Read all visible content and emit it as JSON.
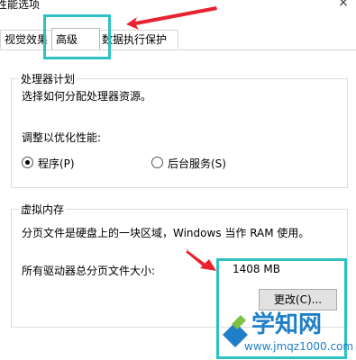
{
  "window": {
    "title": "性能选项",
    "close_glyph": "×"
  },
  "tabs": [
    {
      "label": "视觉效果",
      "selected": false
    },
    {
      "label": "高级",
      "selected": true
    },
    {
      "label": "数据执行保护",
      "selected": false
    }
  ],
  "processor_group": {
    "legend": "处理器计划",
    "description": "选择如何分配处理器资源。",
    "adjust_label": "调整以优化性能:",
    "options": [
      {
        "label": "程序(P)",
        "selected": true
      },
      {
        "label": "后台服务(S)",
        "selected": false
      }
    ]
  },
  "virtual_memory_group": {
    "legend": "虚拟内存",
    "description": "分页文件是硬盘上的一块区域，Windows 当作 RAM 使用。",
    "total_label": "所有驱动器总分页文件大小:",
    "total_value": "1408 MB",
    "change_button": "更改(C)..."
  },
  "watermark": {
    "brand": "学知网",
    "url": "www.jmqz1000.com"
  },
  "annotation_colors": {
    "highlight_box": "#2dc1c4",
    "arrow": "#e8232f",
    "logo_blue": "#1f7fc7",
    "logo_green": "#7dc242"
  }
}
